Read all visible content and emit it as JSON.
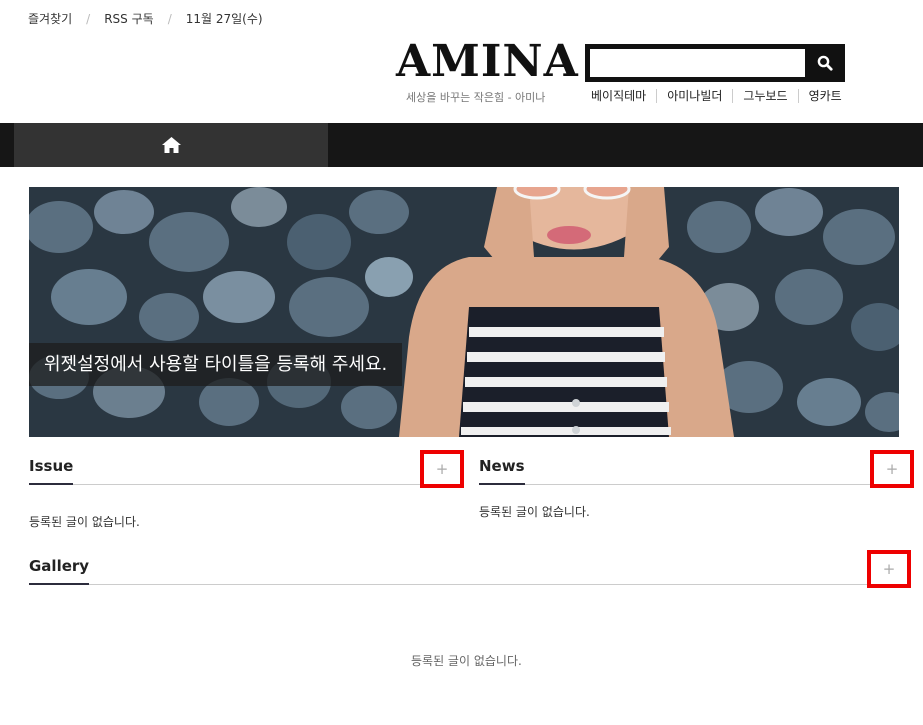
{
  "topbar": {
    "bookmark": "즐겨찾기",
    "rss": "RSS 구독",
    "date": "11월 27일(수)"
  },
  "header": {
    "logo": "AMINA",
    "tagline": "세상을 바꾸는 작은힘 - 아미나"
  },
  "search": {
    "value": "",
    "placeholder": ""
  },
  "quicklinks": [
    "베이직테마",
    "아미나빌더",
    "그누보드",
    "영카트"
  ],
  "banner": {
    "caption": "위젯설정에서 사용할 타이틀을 등록해 주세요."
  },
  "sections": {
    "issue": {
      "title": "Issue",
      "more": "+",
      "empty": "등록된 글이 없습니다."
    },
    "news": {
      "title": "News",
      "more": "+",
      "empty": "등록된 글이 없습니다."
    },
    "gallery": {
      "title": "Gallery",
      "more": "+",
      "empty": "등록된 글이 없습니다."
    }
  },
  "colors": {
    "nav_bg": "#161616",
    "nav_active": "#333333",
    "highlight": "#e00000"
  }
}
